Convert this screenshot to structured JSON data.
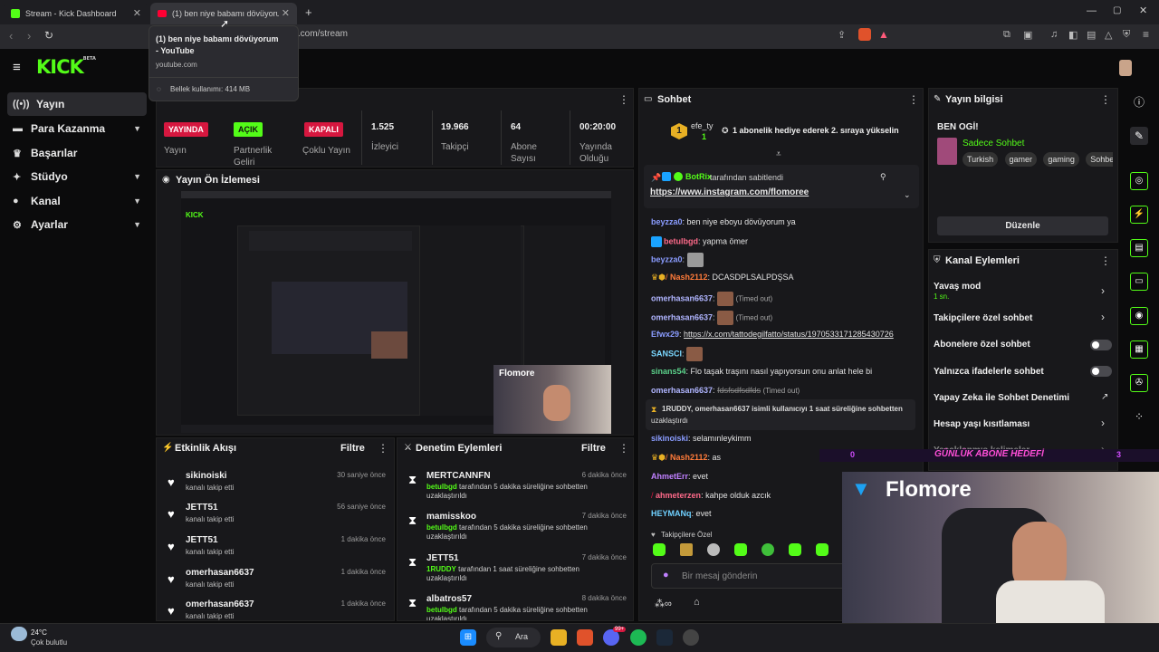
{
  "browser": {
    "tabs": [
      {
        "title": "Stream - Kick Dashboard",
        "active": false
      },
      {
        "title": "(1) ben niye babamı dövüyorum",
        "active": true
      }
    ],
    "url": "rd.kick.com/stream",
    "tooltip": {
      "title": "(1) ben niye babamı dövüyorum - YouTube",
      "domain": "youtube.com",
      "memory": "Bellek kullanımı: 414 MB"
    }
  },
  "app": {
    "logo": "KICK",
    "logo_beta": "BETA",
    "accent": "#53fc18"
  },
  "sidebar": {
    "items": [
      {
        "label": "Yayın",
        "icon": "broadcast-icon",
        "active": true
      },
      {
        "label": "Para Kazanma",
        "icon": "money-icon"
      },
      {
        "label": "Başarılar",
        "icon": "trophy-icon"
      },
      {
        "label": "Stüdyo",
        "icon": "studio-icon"
      },
      {
        "label": "Kanal",
        "icon": "person-icon"
      },
      {
        "label": "Ayarlar",
        "icon": "gear-icon"
      }
    ]
  },
  "stream_stats": {
    "status_badge": "YAYINDA",
    "status_label": "Yayın",
    "partner_badge": "AÇIK",
    "partner_label": "Partnerlik Geliri",
    "multi_badge": "KAPALI",
    "multi_label": "Çoklu Yayın",
    "viewers": "1.525",
    "viewers_label": "İzleyici",
    "followers": "19.966",
    "followers_label": "Takipçi",
    "subs": "64",
    "subs_label": "Abone Sayısı",
    "uptime": "00:20:00",
    "uptime_label": "Yayında Olduğu"
  },
  "preview": {
    "title": "Yayın Ön İzlemesi",
    "overlay_name": "Flomore"
  },
  "activity": {
    "title": "Etkinlik Akışı",
    "filter": "Filtre",
    "rows": [
      {
        "name": "sikinoiski",
        "sub": "kanalı takip etti",
        "time": "30 saniye önce"
      },
      {
        "name": "JETT51",
        "sub": "kanalı takip etti",
        "time": "56 saniye önce"
      },
      {
        "name": "JETT51",
        "sub": "kanalı takip etti",
        "time": "1 dakika önce"
      },
      {
        "name": "omerhasan6637",
        "sub": "kanalı takip etti",
        "time": "1 dakika önce"
      },
      {
        "name": "omerhasan6637",
        "sub": "kanalı takip etti",
        "time": "1 dakika önce"
      }
    ]
  },
  "moderation": {
    "title": "Denetim Eylemleri",
    "filter": "Filtre",
    "rows": [
      {
        "name": "MERTCANNFN",
        "by": "betulbgd",
        "sub": " tarafından 5 dakika süreliğine sohbetten uzaklaştırıldı",
        "time": "6 dakika önce"
      },
      {
        "name": "mamisskoo",
        "by": "betulbgd",
        "sub": " tarafından 5 dakika süreliğine sohbetten uzaklaştırıldı",
        "time": "7 dakika önce"
      },
      {
        "name": "JETT51",
        "by": "1RUDDY",
        "sub": " tarafından 1 saat süreliğine sohbetten uzaklaştırıldı",
        "time": "7 dakika önce"
      },
      {
        "name": "albatros57",
        "by": "betulbgd",
        "sub": " tarafından 5 dakika süreliğine sohbetten uzaklaştırıldı",
        "time": "8 dakika önce"
      }
    ]
  },
  "chat": {
    "title": "Sohbet",
    "gift_user": "efe_ty",
    "gift_count": "1",
    "gift_text": "1 abonelik hediye ederek 2. sıraya yükselin",
    "pinned_by": "BotRix",
    "pinned_suffix": "tarafından sabitlendi",
    "pinned_link": "https://www.instagram.com/flomoree",
    "messages": [
      {
        "user": "beyzza0",
        "color": "#8a9cff",
        "text": ": ben niye eboyu dövüyorum ya"
      },
      {
        "user": "betulbgd",
        "color": "#ff6a8a",
        "text": ": yapma ömer"
      },
      {
        "user": "beyzza0",
        "color": "#8a9cff",
        "text": ":"
      },
      {
        "user": "Nash2112",
        "color": "#ff7b3a",
        "text": ": DCASDPLSALPDŞSA"
      },
      {
        "user": "omerhasan6637",
        "color": "#b0b5ff",
        "text": ":",
        "note": "(Timed out)"
      },
      {
        "user": "omerhasan6637",
        "color": "#b0b5ff",
        "text": ":",
        "note": "(Timed out)"
      },
      {
        "user": "Efwx29",
        "color": "#8a9cff",
        "text": ": ",
        "link": "https://x.com/tattodegilfatto/status/1970533171285430726"
      },
      {
        "user": "SANSCI",
        "color": "#7ad7ff",
        "text": ":"
      },
      {
        "user": "sinans54",
        "color": "#5bd18a",
        "text": ": Flo taşak traşını nasıl yapıyorsun onu anlat hele bi"
      },
      {
        "user": "omerhasan6637",
        "color": "#b0b5ff",
        "text": ": ",
        "strike": "fdsfsdfsdfds",
        "note": "(Timed out)"
      },
      {
        "user": "sikinoiski",
        "color": "#8a9cff",
        "text": ": selamınleykimm"
      },
      {
        "user": "Nash2112",
        "color": "#ff7b3a",
        "text": ": as"
      },
      {
        "user": "AhmetErr",
        "color": "#c080ff",
        "text": ": evet"
      },
      {
        "user": "ahmeterzen",
        "color": "#ff6a8a",
        "text": ": kahpe olduk azcık"
      },
      {
        "user": "HEYMANq",
        "color": "#6fd0ff",
        "text": ": evet"
      }
    ],
    "system_line1": "1RUDDY, omerhasan6637 isimli kullanıcıyı 1 saat süreliğine sohbetten",
    "system_line2": "uzaklaştırdı",
    "followers_only": "Takipçilere Özel",
    "input_placeholder": "Bir mesaj gönderin"
  },
  "stream_info": {
    "title": "Yayın bilgisi",
    "stream_title": "BEN OGİ!",
    "category": "Sadece Sohbet",
    "tags": [
      "Turkish",
      "gamer",
      "gaming",
      "Sohbet"
    ],
    "edit": "Düzenle"
  },
  "channel_actions": {
    "title": "Kanal Eylemleri",
    "items": [
      {
        "label": "Yavaş mod",
        "sub": "1 sn.",
        "kind": "arrow"
      },
      {
        "label": "Takipçilere özel sohbet",
        "kind": "arrow"
      },
      {
        "label": "Abonelere özel sohbet",
        "kind": "toggle"
      },
      {
        "label": "Yalnızca ifadelerle sohbet",
        "kind": "toggle"
      },
      {
        "label": "Yapay Zeka ile Sohbet Denetimi",
        "kind": "external"
      },
      {
        "label": "Hesap yaşı kısıtlaması",
        "kind": "arrow"
      },
      {
        "label": "Yasaklanmış kelimeler",
        "kind": "arrow"
      }
    ],
    "overlay_text": "GÜNLÜK ABONE HEDEFİ"
  },
  "webcam": {
    "name": "Flomore"
  },
  "taskbar": {
    "temp": "24°C",
    "weather": "Çok bulutlu",
    "search": "Ara",
    "badge": "99+"
  }
}
